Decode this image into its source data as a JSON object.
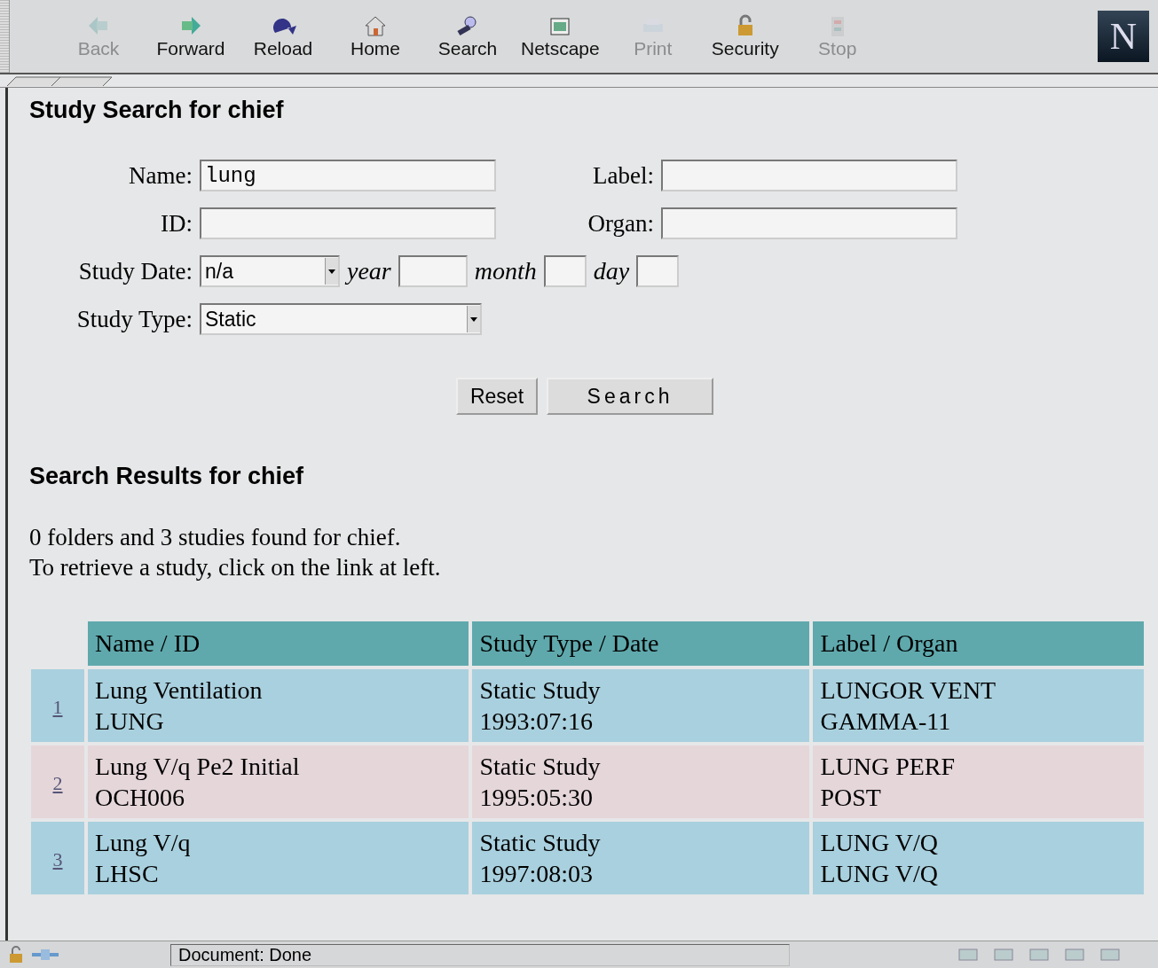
{
  "toolbar": {
    "buttons": [
      {
        "label": "Back",
        "disabled": true
      },
      {
        "label": "Forward",
        "disabled": false
      },
      {
        "label": "Reload",
        "disabled": false
      },
      {
        "label": "Home",
        "disabled": false
      },
      {
        "label": "Search",
        "disabled": false
      },
      {
        "label": "Netscape",
        "disabled": false
      },
      {
        "label": "Print",
        "disabled": true
      },
      {
        "label": "Security",
        "disabled": false
      },
      {
        "label": "Stop",
        "disabled": true
      }
    ],
    "logo": "N"
  },
  "search_form": {
    "title": "Study Search for chief",
    "name": {
      "label": "Name:",
      "value": "lung"
    },
    "label": {
      "label": "Label:"
    },
    "id": {
      "label": "ID:"
    },
    "organ": {
      "label": "Organ:"
    },
    "study_date": {
      "label": "Study Date:",
      "value": "n/a",
      "year_label": "year",
      "month_label": "month",
      "day_label": "day"
    },
    "study_type": {
      "label": "Study Type:",
      "value": "Static"
    },
    "buttons": [
      "Reset",
      "Search"
    ]
  },
  "results": {
    "title": "Search Results for chief",
    "summary": [
      "0 folders and 3 studies found for chief.",
      "To retrieve a study, click on the link at left."
    ],
    "columns": [
      "Name / ID",
      "Study Type / Date",
      "Label / Organ"
    ],
    "rows": [
      {
        "link": "1",
        "color": "#a9d0de",
        "cells": [
          [
            "Lung Ventilation",
            "LUNG"
          ],
          [
            "Static Study",
            "1993:07:16"
          ],
          [
            "LUNGOR VENT",
            "GAMMA-11"
          ]
        ]
      },
      {
        "link": "2",
        "color": "#e5d6da",
        "cells": [
          [
            "Lung V/q Pe2 Initial",
            "OCH006"
          ],
          [
            "Static Study",
            "1995:05:30"
          ],
          [
            "LUNG PERF",
            "POST"
          ]
        ]
      },
      {
        "link": "3",
        "color": "#a9d0de",
        "cells": [
          [
            "Lung V/q",
            "LHSC"
          ],
          [
            "Static Study",
            "1997:08:03"
          ],
          [
            "LUNG V/Q",
            "LUNG V/Q"
          ]
        ]
      }
    ]
  },
  "status_bar": {
    "text": "Document: Done"
  }
}
